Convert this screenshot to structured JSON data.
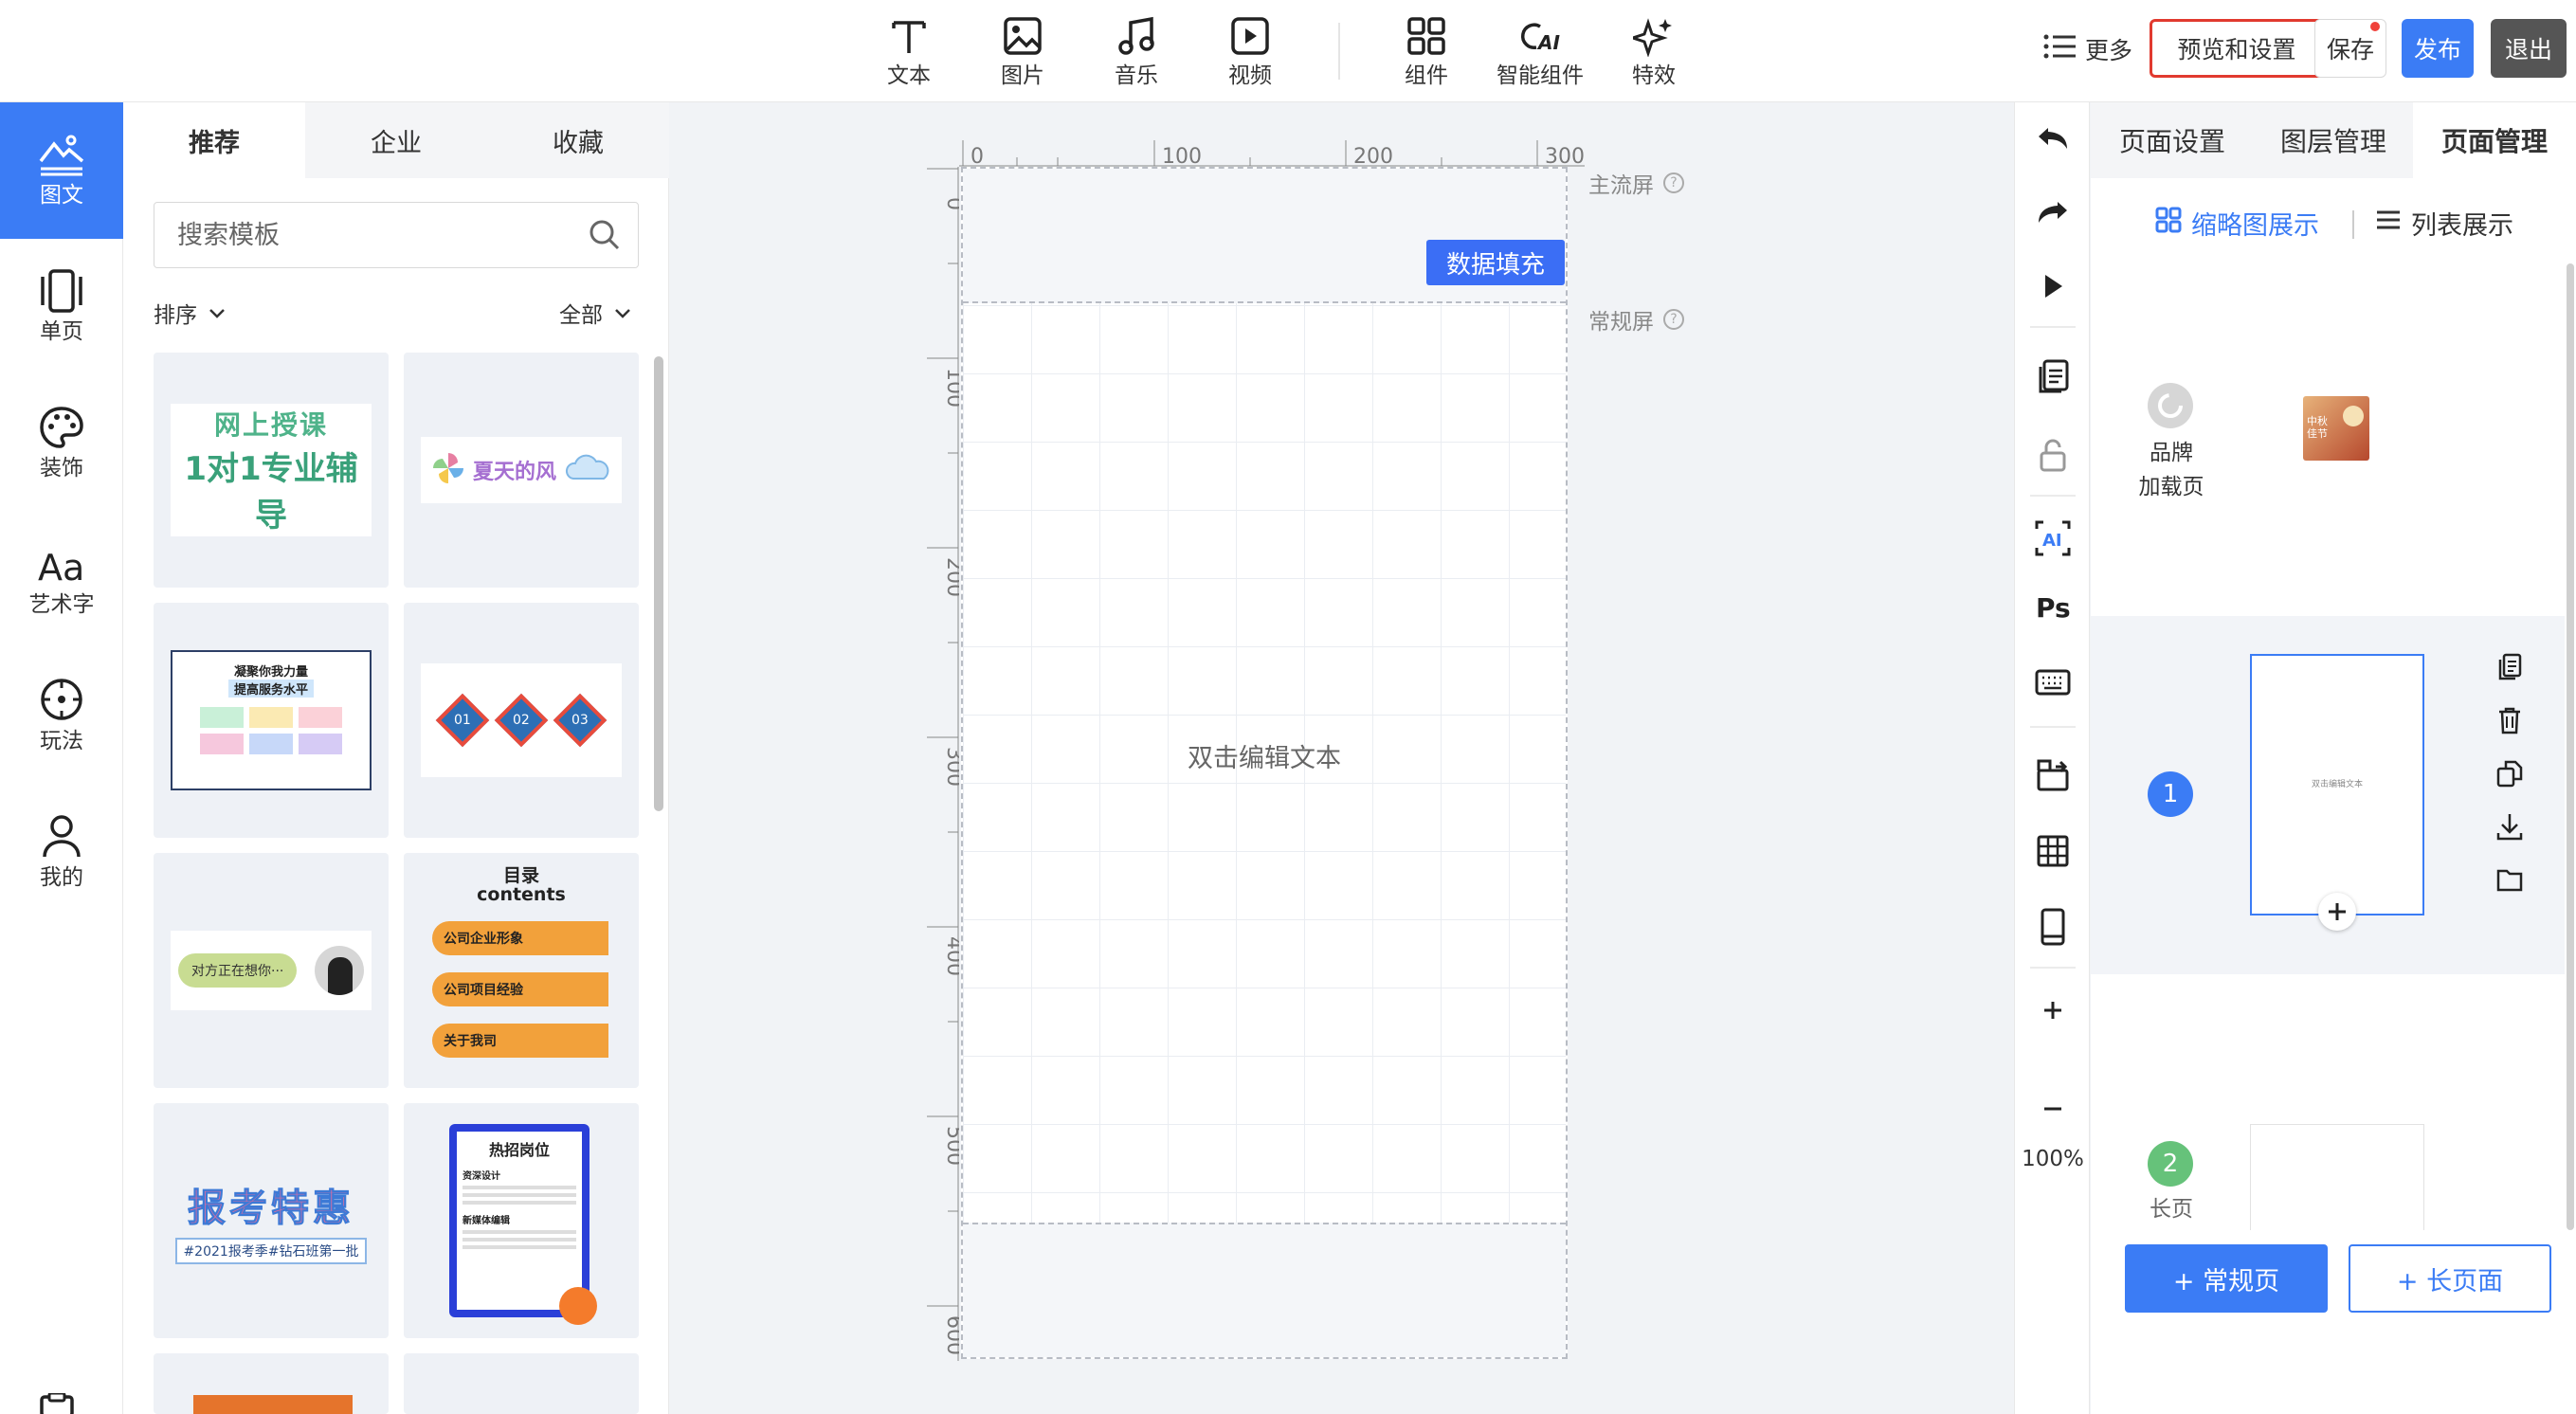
{
  "toolbar": {
    "tools": [
      {
        "label": "文本",
        "icon": "text-icon"
      },
      {
        "label": "图片",
        "icon": "image-icon"
      },
      {
        "label": "音乐",
        "icon": "music-icon"
      },
      {
        "label": "视频",
        "icon": "video-icon"
      },
      {
        "label": "组件",
        "icon": "components-icon"
      },
      {
        "label": "智能组件",
        "icon": "ai-component-icon"
      },
      {
        "label": "特效",
        "icon": "sparkle-icon"
      }
    ],
    "more_label": "更多",
    "preview_label": "预览和设置",
    "save_label": "保存",
    "publish_label": "发布",
    "exit_label": "退出"
  },
  "rail": {
    "items": [
      {
        "label": "图文",
        "icon": "image-text-icon",
        "active": true
      },
      {
        "label": "单页",
        "icon": "single-page-icon"
      },
      {
        "label": "装饰",
        "icon": "palette-icon"
      },
      {
        "label": "艺术字",
        "icon": "art-text-icon"
      },
      {
        "label": "玩法",
        "icon": "compass-icon"
      },
      {
        "label": "我的",
        "icon": "user-icon"
      }
    ]
  },
  "templates": {
    "tabs": [
      "推荐",
      "企业",
      "收藏"
    ],
    "search_placeholder": "搜索模板",
    "sort_label": "排序",
    "filter_label": "全部",
    "cards": [
      {
        "lines": [
          "网上授课",
          "1对1专业辅导"
        ]
      },
      {
        "lines": [
          "夏天的风"
        ]
      },
      {
        "lines": [
          "凝聚你我力量",
          "提高服务水平"
        ]
      },
      {
        "lines": [
          "01",
          "02",
          "03"
        ]
      },
      {
        "lines": [
          "对方正在想你···"
        ]
      },
      {
        "lines": [
          "目录",
          "contents",
          "公司企业形象",
          "公司项目经验",
          "关于我司"
        ]
      },
      {
        "lines": [
          "报考特惠",
          "#2021报考季#钻石班第一批"
        ]
      },
      {
        "lines": [
          "热招岗位",
          "资深设计",
          "新媒体编辑"
        ]
      }
    ]
  },
  "canvas": {
    "ruler_h": [
      "0",
      "100",
      "200",
      "300"
    ],
    "ruler_v": [
      "0",
      "100",
      "200",
      "300",
      "400",
      "500",
      "600"
    ],
    "fill_button": "数据填充",
    "edit_text": "双击编辑文本",
    "main_screen_label": "主流屏",
    "normal_screen_label": "常规屏"
  },
  "right_tools": {
    "zoom": "100%"
  },
  "page_manager": {
    "tabs": [
      "页面设置",
      "图层管理",
      "页面管理"
    ],
    "view_thumb": "缩略图展示",
    "view_list": "列表展示",
    "brand_label_1": "品牌",
    "brand_label_2": "加载页",
    "brand_thumb_text": "中秋佳节",
    "page1_number": "1",
    "page1_thumb_text": "双击编辑文本",
    "page2_number": "2",
    "page2_label": "长页",
    "add_normal": "+ 常规页",
    "add_long": "+ 长页面"
  },
  "colors": {
    "primary": "#3b7cf5",
    "highlight_border": "#e13a2f",
    "page2_badge": "#66c27a"
  }
}
